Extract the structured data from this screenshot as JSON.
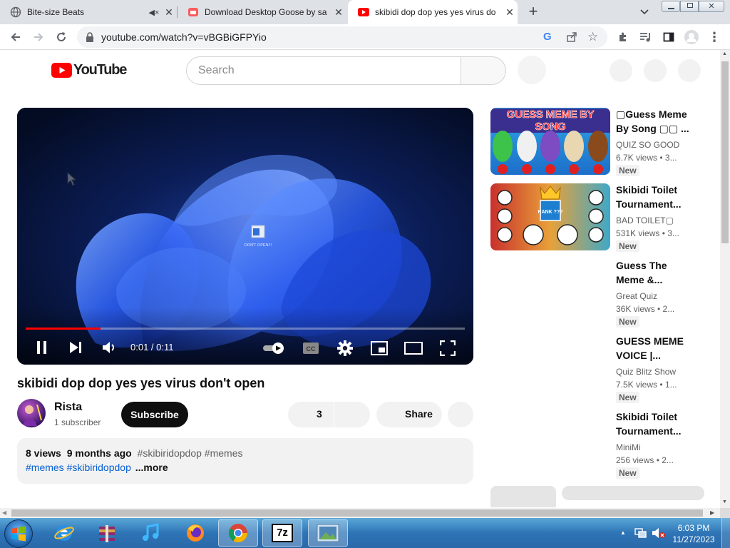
{
  "browser": {
    "tabs": [
      {
        "title": "Bite-size Beats",
        "active": false
      },
      {
        "title": "Download Desktop Goose by sa",
        "active": false
      },
      {
        "title": "skibidi dop dop yes yes virus do",
        "active": true
      }
    ],
    "new_tab": "+",
    "url": "youtube.com/watch?v=vBGBiGFPYio"
  },
  "youtube": {
    "logo": "YouTube",
    "search_placeholder": "Search",
    "video": {
      "elapsed": "0:01 / 0:11",
      "progress": 0.17,
      "desktop_icon_label": "DON'T OPEN!!!",
      "title": "skibidi dop dop yes yes virus don't open",
      "channel": "Rista",
      "subscribers": "1 subscriber",
      "subscribe_label": "Subscribe",
      "likes": "3",
      "share_label": "Share"
    },
    "description": {
      "views": "8 views",
      "age": "9 months ago",
      "tags_line1": "#skibiridopdop #memes",
      "tags_line2": "#memes #skibiridopdop",
      "more": "...more"
    },
    "recommendations": [
      {
        "title": "▢Guess Meme By Song ▢▢ ...",
        "channel": "QUIZ SO GOOD",
        "meta": "6.7K views  • 3...",
        "badge": "New",
        "thumb_text": "GUESS MEME BY SONG"
      },
      {
        "title": "Skibidi Toilet Tournament...",
        "channel": "BAD TOILET▢",
        "meta": "531K views  • 3...",
        "badge": "New",
        "thumb_text": "RANK ???"
      },
      {
        "title": "Guess The Meme &...",
        "channel": "Great Quiz",
        "meta": "36K views  • 2...",
        "badge": "New"
      },
      {
        "title": "GUESS MEME VOICE |...",
        "channel": "Quiz Blitz Show",
        "meta": "7.5K views  • 1...",
        "badge": "New"
      },
      {
        "title": "Skibidi Toilet Tournament...",
        "channel": "MiniMi",
        "meta": "256 views  • 2...",
        "badge": "New"
      }
    ]
  },
  "taskbar": {
    "time": "6:03 PM",
    "date": "11/27/2023",
    "seven_zip": "7z"
  }
}
